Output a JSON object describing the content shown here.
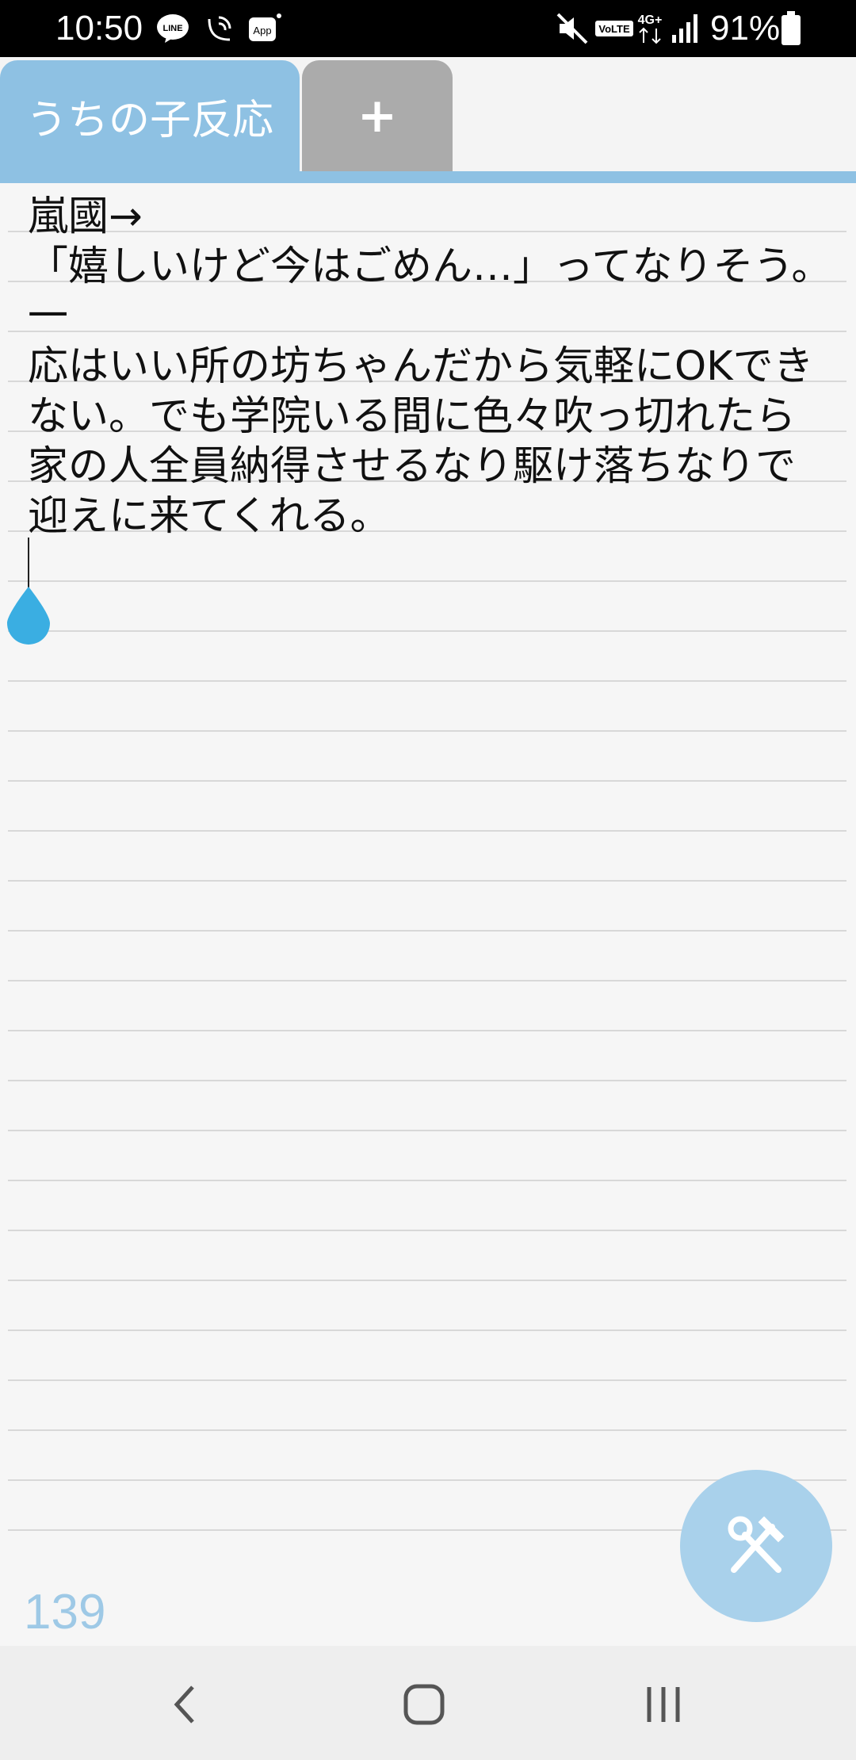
{
  "status_bar": {
    "time": "10:50",
    "icons": [
      "line-icon",
      "wifi-call-icon",
      "app-icon",
      "mute-icon",
      "volte-icon",
      "4g-data-icon",
      "signal-icon",
      "battery-icon"
    ],
    "line_label": "LINE",
    "app_label": "App",
    "volte_label": "VoLTE",
    "network_label": "4G+",
    "battery_percent": "91%"
  },
  "tabs": [
    {
      "label": "うちの子反応",
      "active": true
    },
    {
      "label": "+",
      "active": false
    }
  ],
  "note": {
    "text": "嵐國→\n「嬉しいけど今はごめん…」ってなりそう。一\n応はいい所の坊ちゃんだから気軽にOKでき\nない。でも学院いる間に色々吹っ切れたら\n家の人全員納得させるなり駆け落ちなりで\n迎えに来てくれる。"
  },
  "char_count": "139",
  "fab": {
    "icon": "tools-icon"
  },
  "nav": {
    "icons": [
      "back-icon",
      "home-icon",
      "recents-icon"
    ]
  },
  "colors": {
    "accent": "#8ec1e3",
    "fab": "#a9d1eb",
    "handle": "#3aaee2",
    "count": "#9ec9e6"
  }
}
